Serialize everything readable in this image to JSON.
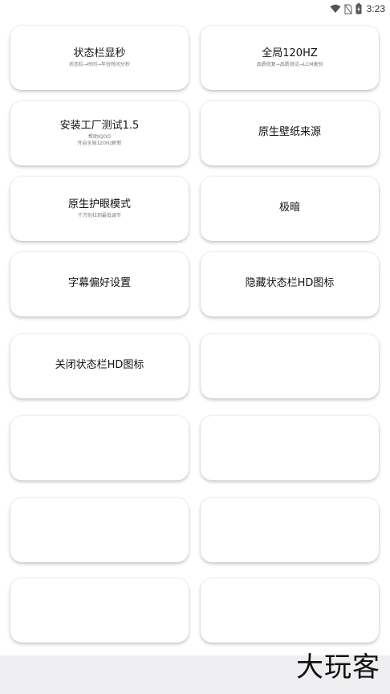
{
  "status_bar": {
    "time": "3:23"
  },
  "cards": [
    {
      "title": "状态栏显秒",
      "subtitle": "状态栏→时间→年份时间分秒"
    },
    {
      "title": "全局120HZ",
      "subtitle": "品质修复→品质测试→LCM类别"
    },
    {
      "title": "安装工厂测试1.5",
      "subtitle": "帮助IQOO",
      "subtitle2": "开启全局120Hz刷新"
    },
    {
      "title": "原生壁纸来源",
      "subtitle": ""
    },
    {
      "title": "原生护眼模式",
      "subtitle": "千万别拉到最低调节"
    },
    {
      "title": "极暗",
      "subtitle": ""
    },
    {
      "title": "字幕偏好设置",
      "subtitle": ""
    },
    {
      "title": "隐藏状态栏HD图标",
      "subtitle": ""
    },
    {
      "title": "关闭状态栏HD图标",
      "subtitle": ""
    },
    {
      "title": "",
      "subtitle": ""
    },
    {
      "title": "",
      "subtitle": ""
    },
    {
      "title": "",
      "subtitle": ""
    },
    {
      "title": "",
      "subtitle": ""
    },
    {
      "title": "",
      "subtitle": ""
    },
    {
      "title": "",
      "subtitle": ""
    },
    {
      "title": "",
      "subtitle": ""
    }
  ],
  "watermark": "大玩客"
}
